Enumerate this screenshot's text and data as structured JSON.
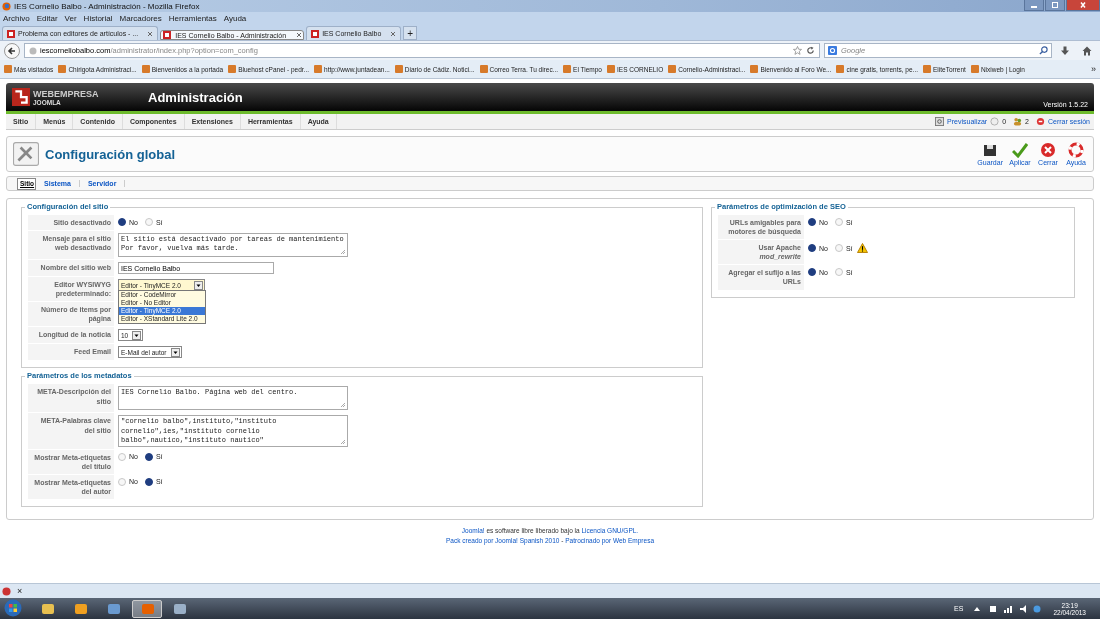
{
  "window": {
    "title": "IES Cornelio Balbo - Administración - Mozilla Firefox"
  },
  "menu": [
    "Archivo",
    "Editar",
    "Ver",
    "Historial",
    "Marcadores",
    "Herramientas",
    "Ayuda"
  ],
  "tabs": [
    {
      "label": "Problema con editores de artículos - ...",
      "selected": false
    },
    {
      "label": "IES Cornelio Balbo - Administración",
      "selected": true
    },
    {
      "label": "IES Cornelio Balbo",
      "selected": false
    }
  ],
  "new_tab": "+",
  "address_bar": {
    "domain": "iescorneliobalbo.com",
    "path": "/administrator/index.php?option=com_config"
  },
  "search": {
    "placeholder": "Google"
  },
  "bookmarks": [
    "Más visitados",
    "Chirigota Administraci...",
    "Bienvenidos a la portada",
    "Bluehost cPanel - pedr...",
    "http://www.juntadean...",
    "Diario de Cádiz. Notici...",
    "Correo Terra. Tu direc...",
    "El Tiempo",
    "IES CORNELIO",
    "Cornelio-Administraci...",
    "Bienvenido al Foro We...",
    "cine gratis, torrents, pe...",
    "EliteTorrent",
    "Nixiweb | Login"
  ],
  "bookmarks_more": "»",
  "header": {
    "brand": "WEBEMPRESA",
    "brand_sub": "JOOMLA",
    "title": "Administración",
    "version": "Versión 1.5.22"
  },
  "admin_menu": [
    "Sitio",
    "Menús",
    "Contenido",
    "Componentes",
    "Extensiones",
    "Herramientas",
    "Ayuda"
  ],
  "status": {
    "preview": "Previsualizar",
    "messages": "0",
    "users": "2",
    "logout": "Cerrar sesión"
  },
  "page_title": "Configuración global",
  "toolbar": [
    {
      "label": "Guardar",
      "kind": "save"
    },
    {
      "label": "Aplicar",
      "kind": "apply"
    },
    {
      "label": "Cerrar",
      "kind": "cancel"
    },
    {
      "label": "Ayuda",
      "kind": "help"
    }
  ],
  "subtabs": [
    {
      "label": "Sitio",
      "selected": true
    },
    {
      "label": "Sistema",
      "selected": false
    },
    {
      "label": "Servidor",
      "selected": false
    }
  ],
  "site_config": {
    "legend": "Configuración del sitio",
    "rows": [
      {
        "label": "Sitio desactivado",
        "kind": "radio",
        "options": [
          {
            "label": "No",
            "selected": true
          },
          {
            "label": "Sí",
            "selected": false
          }
        ]
      },
      {
        "label": "Mensaje para el sitio web desactivado",
        "kind": "textarea",
        "value": "El sitio está desactivado por tareas de mantenimiento\nPor favor, vuelva más tarde."
      },
      {
        "label": "Nombre del sitio web",
        "kind": "text",
        "value": "IES Cornelio Balbo"
      },
      {
        "label": "Editor WYSIWYG predeterminado:",
        "kind": "select",
        "value": "Editor - TinyMCE 2.0",
        "options": [
          {
            "label": "Editor - CodeMirror",
            "selected": false
          },
          {
            "label": "Editor - No Editor",
            "selected": false
          },
          {
            "label": "Editor - TinyMCE 2.0",
            "selected": true
          },
          {
            "label": "Editor - XStandard Lite 2.0",
            "selected": false
          }
        ]
      },
      {
        "label": "Número de items por página",
        "kind": "covered"
      },
      {
        "label": "Longitud de la noticia",
        "kind": "select",
        "value": "10"
      },
      {
        "label": "Feed Email",
        "kind": "select",
        "value": "E-Mail del autor"
      }
    ]
  },
  "metadata": {
    "legend": "Parámetros de los metadatos",
    "rows": [
      {
        "label": "META-Descripción del sitio",
        "kind": "textarea",
        "value": "IES Cornelio Balbo. Página web del centro."
      },
      {
        "label": "META-Palabras clave del sitio",
        "kind": "textarea",
        "value": "\"cornelio balbo\",instituto,\"instituto cornelio\",ies,\"instituto cornelio balbo\",nautico,\"instituto nautico\""
      },
      {
        "label": "Mostrar Meta-etiquetas del título",
        "kind": "radio",
        "options": [
          {
            "label": "No",
            "selected": false
          },
          {
            "label": "Sí",
            "selected": true
          }
        ]
      },
      {
        "label": "Mostrar Meta-etiquetas del autor",
        "kind": "radio",
        "options": [
          {
            "label": "No",
            "selected": false
          },
          {
            "label": "Sí",
            "selected": true
          }
        ]
      }
    ]
  },
  "seo": {
    "legend": "Parámetros de optimización de SEO",
    "rows": [
      {
        "label": "URLs amigables para motores de búsqueda",
        "kind": "radio",
        "warning": false,
        "options": [
          {
            "label": "No",
            "selected": true
          },
          {
            "label": "Sí",
            "selected": false
          }
        ]
      },
      {
        "label": "Usar Apache *mod_rewrite*",
        "kind": "radio",
        "warning": true,
        "options": [
          {
            "label": "No",
            "selected": true
          },
          {
            "label": "Sí",
            "selected": false
          }
        ]
      },
      {
        "label": "Agregar el sufijo a las URLs",
        "kind": "radio",
        "warning": false,
        "options": [
          {
            "label": "No",
            "selected": true
          },
          {
            "label": "Sí",
            "selected": false
          }
        ]
      }
    ]
  },
  "footer": [
    [
      {
        "text": "Joomla!",
        "link": true
      },
      {
        "text": " es software libre liberado bajo la ",
        "link": false
      },
      {
        "text": "Licencia GNU/GPL.",
        "link": true
      }
    ],
    [
      {
        "text": "Pack creado por Joomla! Spanish 2010",
        "link": true
      },
      {
        "text": " - ",
        "link": false
      },
      {
        "text": "Patrocinado por Web Empresa",
        "link": true
      }
    ]
  ],
  "addon_bar": {
    "close": "×"
  },
  "taskbar": {
    "apps": [
      {
        "selected": false
      },
      {
        "selected": false
      },
      {
        "selected": false
      },
      {
        "selected": true
      },
      {
        "selected": false
      }
    ],
    "language": "ES",
    "time": "23:19",
    "date": "22/04/2013"
  }
}
